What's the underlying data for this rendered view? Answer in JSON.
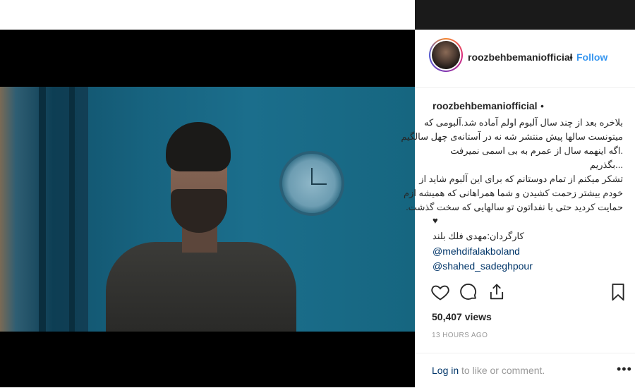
{
  "post": {
    "username": "roozbehbemaniofficial",
    "separator": "•",
    "follow_label": "Follow"
  },
  "caption": {
    "username": "roozbehbemaniofficial",
    "separator": "•",
    "lines": [
      "بلاخره بعد از چند سال آلبوم اولم آماده شد.آلبومی که",
      "میتونست سالها پیش منتشر شه نه در آستانه‌ی چهل سالگیم",
      ".اگه اینهمه سال از عمرم به بی اسمی نمیرفت",
      "...بگذریم",
      "تشکر میکنم از تمام دوستانم که برای این آلبوم شاید از",
      "خودم بیشتر زحمت کشیدن و شما همراهانی که همیشه ازم",
      "حمایت کردید حتی با نفداتون تو سالهایی که سخت گذشت."
    ],
    "heart": "♥",
    "credit": "کارگردان:مهدی فلك بلند",
    "mentions": [
      "@mehdifalakboland",
      "@shahed_sadeghpour"
    ]
  },
  "actions": {
    "like_icon": "heart-outline-icon",
    "comment_icon": "comment-bubble-icon",
    "share_icon": "share-upload-icon",
    "save_icon": "bookmark-icon"
  },
  "views_text": "50,407 views",
  "time_text": "13 HOURS AGO",
  "comment": {
    "login_link": "Log in",
    "login_rest": " to like or comment.",
    "more_label": "•••"
  },
  "colors": {
    "link_blue": "#3897f0",
    "mention_blue": "#003569",
    "text": "#262626",
    "muted": "#999999"
  }
}
